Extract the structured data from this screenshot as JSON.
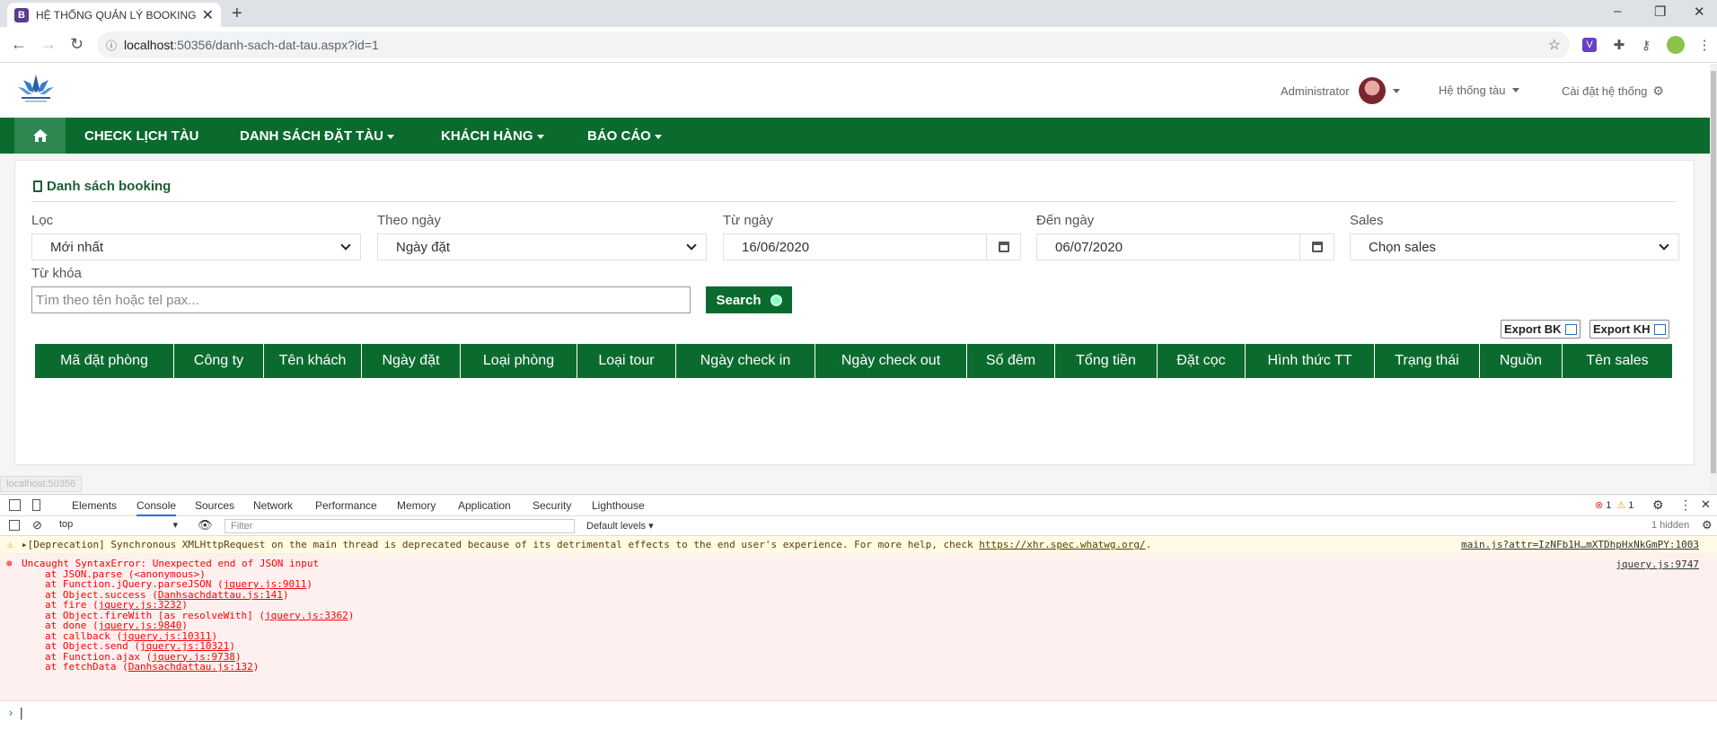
{
  "browser": {
    "tab_title": "HỆ THỐNG QUẢN LÝ BOOKING T",
    "tab_favicon_letter": "B",
    "url_host": "localhost",
    "url_path": ":50356/danh-sach-dat-tau.aspx?id=1",
    "status_url": "localhost:50356",
    "extension_v_letter": "V"
  },
  "header": {
    "user": "Administrator",
    "system_menu": "Hệ thống tàu",
    "settings": "Cài đặt hệ thống"
  },
  "nav": {
    "items": [
      {
        "label": "CHECK LỊCH TÀU",
        "dropdown": false
      },
      {
        "label": "DANH SÁCH ĐẶT TÀU",
        "dropdown": true
      },
      {
        "label": "KHÁCH HÀNG",
        "dropdown": true
      },
      {
        "label": "BÁO CÁO",
        "dropdown": true
      }
    ]
  },
  "card": {
    "title": "Danh sách booking",
    "filters": {
      "loc_label": "Lọc",
      "loc_value": "Mới nhất",
      "theo_ngay_label": "Theo ngày",
      "theo_ngay_value": "Ngày đặt",
      "tu_ngay_label": "Từ ngày",
      "tu_ngay_value": "16/06/2020",
      "den_ngay_label": "Đến ngày",
      "den_ngay_value": "06/07/2020",
      "sales_label": "Sales",
      "sales_value": "Chọn sales"
    },
    "keyword_label": "Từ khóa",
    "keyword_placeholder": "Tìm theo tên hoặc tel pax...",
    "search_label": "Search",
    "export_bk": "Export BK",
    "export_kh": "Export KH",
    "columns": [
      "Mã đặt phòng",
      "Công ty",
      "Tên khách",
      "Ngày đặt",
      "Loại phòng",
      "Loại tour",
      "Ngày check in",
      "Ngày check out",
      "Số đêm",
      "Tổng tiền",
      "Đặt cọc",
      "Hình thức TT",
      "Trạng thái",
      "Nguồn",
      "Tên sales"
    ]
  },
  "devtools": {
    "tabs": [
      "Elements",
      "Console",
      "Sources",
      "Network",
      "Performance",
      "Memory",
      "Application",
      "Security",
      "Lighthouse"
    ],
    "active_tab": "Console",
    "error_count": "1",
    "warning_count": "1",
    "context": "top",
    "filter_placeholder": "Filter",
    "levels": "Default levels",
    "hidden": "1 hidden",
    "warning_text": "▸[Deprecation] Synchronous XMLHttpRequest on the main thread is deprecated because of its detrimental effects to the end user's experience. For more help, check ",
    "warning_link": "https://xhr.spec.whatwg.org/",
    "warning_link_suffix": ".",
    "warning_source": "main.js?attr=IzNFb1H…mXTDhpHxNkGmPY:1003",
    "error_head": "Uncaught SyntaxError: Unexpected end of JSON input",
    "error_source": "jquery.js:9747",
    "stack": [
      {
        "text": "at JSON.parse (<anonymous>)",
        "pre": "at JSON.parse (",
        "link": "",
        "post": "<anonymous>)"
      },
      {
        "pre": "at Function.jQuery.parseJSON (",
        "link": "jquery.js:9011",
        "post": ")"
      },
      {
        "pre": "at Object.success (",
        "link": "Danhsachdattau.js:141",
        "post": ")"
      },
      {
        "pre": "at fire (",
        "link": "jquery.js:3232",
        "post": ")"
      },
      {
        "pre": "at Object.fireWith [as resolveWith] (",
        "link": "jquery.js:3362",
        "post": ")"
      },
      {
        "pre": "at done (",
        "link": "jquery.js:9840",
        "post": ")"
      },
      {
        "pre": "at callback (",
        "link": "jquery.js:10311",
        "post": ")"
      },
      {
        "pre": "at Object.send (",
        "link": "jquery.js:10321",
        "post": ")"
      },
      {
        "pre": "at Function.ajax (",
        "link": "jquery.js:9738",
        "post": ")"
      },
      {
        "pre": "at fetchData (",
        "link": "Danhsachdattau.js:132",
        "post": ")"
      }
    ]
  }
}
